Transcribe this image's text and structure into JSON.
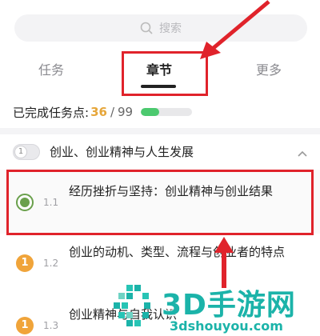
{
  "search": {
    "placeholder": "搜索"
  },
  "tabs": [
    {
      "label": "任务"
    },
    {
      "label": "章节",
      "active": true
    },
    {
      "label": "更多"
    }
  ],
  "progress": {
    "label": "已完成任务点:",
    "completed": "36",
    "separator": "/",
    "total": "99",
    "fill_fraction": 0.36
  },
  "chapter": {
    "toggle_label": "1",
    "title": "创业、创业精神与人生发展"
  },
  "lessons": [
    {
      "number": "1.1",
      "title": "经历挫折与坚持：创业精神与创业结果",
      "status": "in-progress"
    },
    {
      "number": "1.2",
      "title": "创业的动机、类型、流程与创业者的特点",
      "badge": "1"
    },
    {
      "number": "1.3",
      "title": "创业精神与自我认识",
      "badge": "1"
    }
  ],
  "watermark": {
    "brand": "3D手游网",
    "url": "3dshouyou.com"
  },
  "colors": {
    "highlight": "#e0232b",
    "progress_done": "#e6a63a",
    "progress_bar": "#4cc96f",
    "lesson_current": "#6aa04c",
    "lesson_pending": "#f0a43a",
    "watermark": "#1bb3a9"
  }
}
